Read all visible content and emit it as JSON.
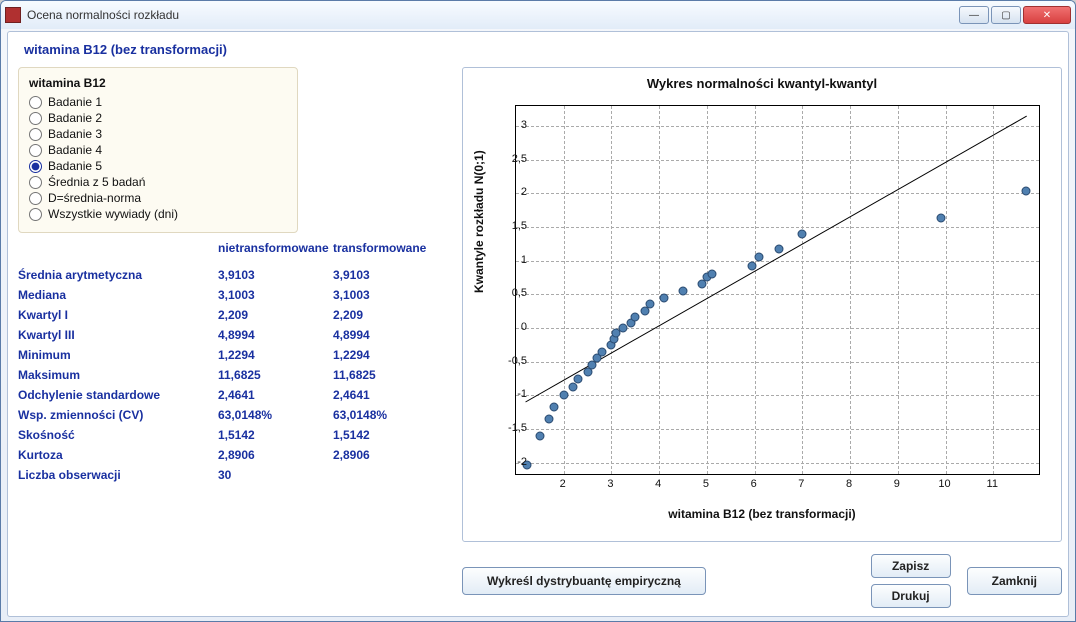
{
  "window": {
    "title": "Ocena normalności rozkładu"
  },
  "header": "witamina B12 (bez transformacji)",
  "group": {
    "legend": "witamina B12",
    "options": [
      "Badanie 1",
      "Badanie 2",
      "Badanie 3",
      "Badanie 4",
      "Badanie 5",
      "Średnia z 5 badań",
      "D=średnia-norma",
      "Wszystkie wywiady (dni)"
    ],
    "selected": 4
  },
  "stats": {
    "headers": {
      "c2": "nietransformowane",
      "c3": "transformowane"
    },
    "rows": [
      {
        "label": "Średnia arytmetyczna",
        "v1": "3,9103",
        "v2": "3,9103"
      },
      {
        "label": "Mediana",
        "v1": "3,1003",
        "v2": "3,1003"
      },
      {
        "label": "Kwartyl I",
        "v1": "2,209",
        "v2": "2,209"
      },
      {
        "label": "Kwartyl III",
        "v1": "4,8994",
        "v2": "4,8994"
      },
      {
        "label": "Minimum",
        "v1": "1,2294",
        "v2": "1,2294"
      },
      {
        "label": "Maksimum",
        "v1": "11,6825",
        "v2": "11,6825"
      },
      {
        "label": "Odchylenie standardowe",
        "v1": "2,4641",
        "v2": "2,4641"
      },
      {
        "label": "Wsp. zmienności (CV)",
        "v1": "63,0148%",
        "v2": "63,0148%"
      },
      {
        "label": "Skośność",
        "v1": "1,5142",
        "v2": "1,5142"
      },
      {
        "label": "Kurtoza",
        "v1": "2,8906",
        "v2": "2,8906"
      },
      {
        "label": "Liczba obserwacji",
        "v1": "30",
        "v2": ""
      }
    ]
  },
  "chart_data": {
    "type": "scatter",
    "title": "Wykres normalności kwantyl-kwantyl",
    "xlabel": "witamina B12 (bez transformacji)",
    "ylabel": "Kwantyle rozkładu N(0;1)",
    "xlim": [
      1,
      12
    ],
    "ylim": [
      -2.2,
      3.3
    ],
    "x_ticks": [
      2,
      3,
      4,
      5,
      6,
      7,
      8,
      9,
      10,
      11
    ],
    "y_ticks": [
      -2,
      -1.5,
      -1,
      -0.5,
      0,
      0.5,
      1,
      1.5,
      2,
      2.5,
      3
    ],
    "reference_line": {
      "x1": 1.2,
      "y1": -1.1,
      "x2": 11.7,
      "y2": 3.15
    },
    "points": [
      {
        "x": 1.23,
        "y": -2.04
      },
      {
        "x": 1.5,
        "y": -1.6
      },
      {
        "x": 1.7,
        "y": -1.35
      },
      {
        "x": 1.8,
        "y": -1.17
      },
      {
        "x": 2.0,
        "y": -1.0
      },
      {
        "x": 2.2,
        "y": -0.88
      },
      {
        "x": 2.3,
        "y": -0.76
      },
      {
        "x": 2.5,
        "y": -0.65
      },
      {
        "x": 2.6,
        "y": -0.55
      },
      {
        "x": 2.7,
        "y": -0.45
      },
      {
        "x": 2.8,
        "y": -0.35
      },
      {
        "x": 3.0,
        "y": -0.26
      },
      {
        "x": 3.05,
        "y": -0.17
      },
      {
        "x": 3.1,
        "y": -0.08
      },
      {
        "x": 3.25,
        "y": 0.0
      },
      {
        "x": 3.4,
        "y": 0.08
      },
      {
        "x": 3.5,
        "y": 0.17
      },
      {
        "x": 3.7,
        "y": 0.26
      },
      {
        "x": 3.8,
        "y": 0.35
      },
      {
        "x": 4.1,
        "y": 0.45
      },
      {
        "x": 4.5,
        "y": 0.55
      },
      {
        "x": 4.9,
        "y": 0.65
      },
      {
        "x": 5.0,
        "y": 0.76
      },
      {
        "x": 5.1,
        "y": 0.8
      },
      {
        "x": 5.95,
        "y": 0.92
      },
      {
        "x": 6.1,
        "y": 1.05
      },
      {
        "x": 6.5,
        "y": 1.18
      },
      {
        "x": 7.0,
        "y": 1.4
      },
      {
        "x": 9.9,
        "y": 1.63
      },
      {
        "x": 11.68,
        "y": 2.04
      }
    ]
  },
  "buttons": {
    "empirical": "Wykreśl dystrybuantę empiryczną",
    "save": "Zapisz",
    "print": "Drukuj",
    "close": "Zamknij"
  }
}
